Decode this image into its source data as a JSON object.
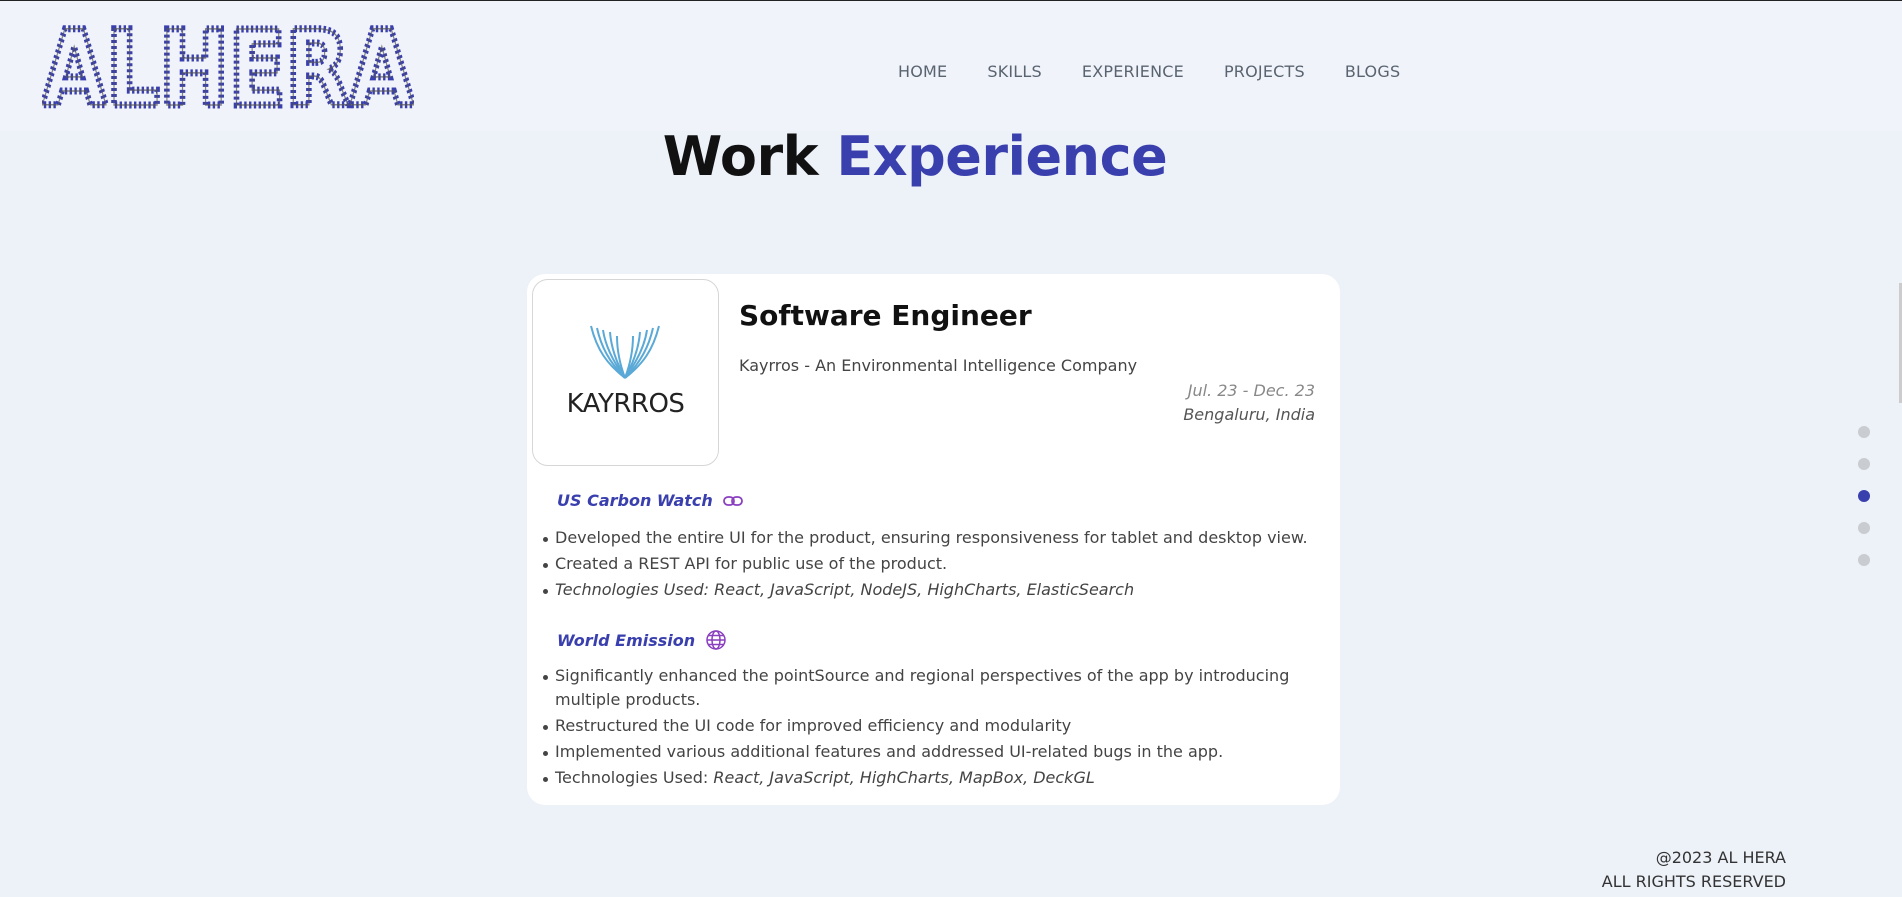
{
  "brand": {
    "logo_text": "ALHERA"
  },
  "nav": {
    "items": [
      "HOME",
      "SKILLS",
      "EXPERIENCE",
      "PROJECTS",
      "BLOGS"
    ]
  },
  "section": {
    "title_part1": "Work",
    "title_part2": "Experience"
  },
  "experience": {
    "job_title": "Software Engineer",
    "company": "Kayrros - An Environmental Intelligence Company",
    "company_logo_text": "KAYRROS",
    "dates": "Jul. 23 - Dec. 23",
    "location": "Bengaluru, India",
    "projects": [
      {
        "name": "US Carbon Watch",
        "icon": "link-icon",
        "bullets": [
          "Developed the entire UI for the product, ensuring responsiveness for tablet and desktop view.",
          "Created a REST API for public use of the product.",
          "Technologies Used: React, JavaScript, NodeJS, HighCharts, ElasticSearch"
        ]
      },
      {
        "name": "World Emission",
        "icon": "globe-icon",
        "bullets": [
          "Significantly enhanced the pointSource and regional perspectives of the app by introducing multiple products.",
          "Restructured the UI code for improved efficiency and modularity",
          "Implemented various additional features and addressed UI-related bugs in the app."
        ],
        "tech_label": "Technologies Used:",
        "tech_list": "React, JavaScript, HighCharts, MapBox, DeckGL"
      }
    ]
  },
  "page_dots": {
    "count": 5,
    "active_index": 2
  },
  "footer": {
    "line1": "@2023 AL HERA",
    "line2": "ALL RIGHTS RESERVED"
  },
  "colors": {
    "accent": "#3a3fae",
    "background": "#edf1f8",
    "text": "#333333"
  }
}
